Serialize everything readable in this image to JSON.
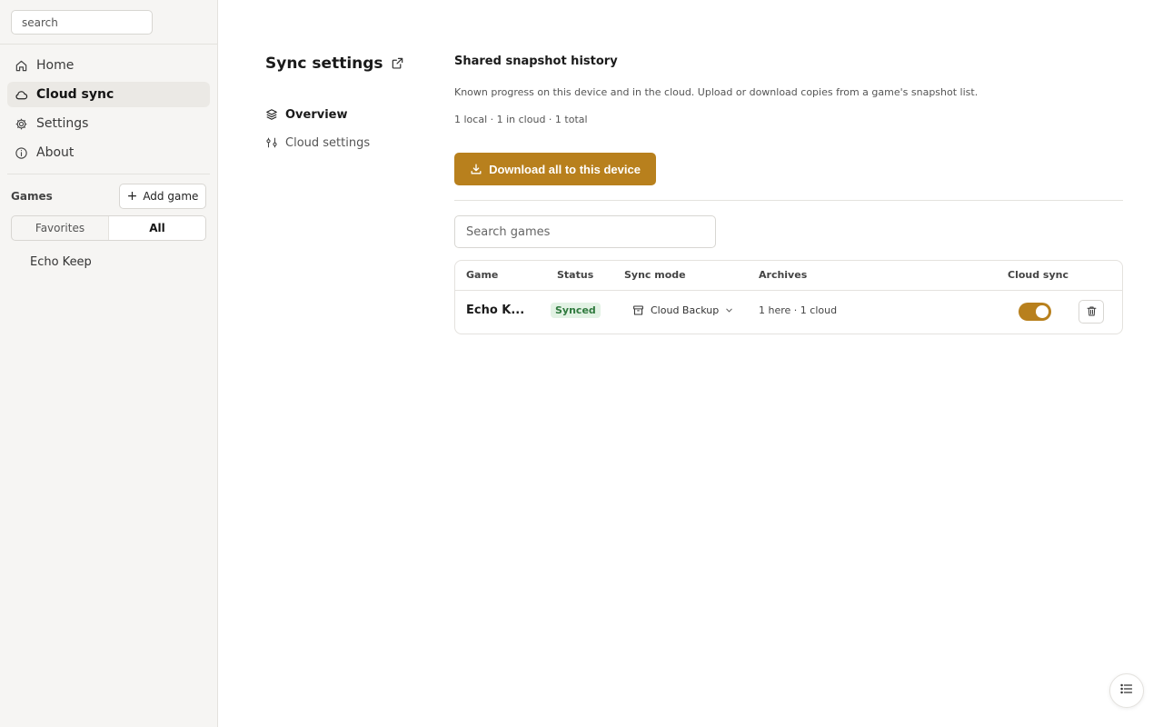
{
  "sidebar": {
    "search_placeholder": "search",
    "nav": [
      {
        "label": "Home",
        "icon": "home-icon"
      },
      {
        "label": "Cloud sync",
        "icon": "cloud-icon",
        "active": true
      },
      {
        "label": "Settings",
        "icon": "gear-icon"
      },
      {
        "label": "About",
        "icon": "info-icon"
      }
    ],
    "games_label": "Games",
    "add_game_label": "Add game",
    "filter": {
      "favorites": "Favorites",
      "all": "All",
      "selected": "All"
    },
    "games": [
      "Echo Keep"
    ]
  },
  "page": {
    "title": "Sync settings",
    "subnav": [
      {
        "label": "Overview",
        "icon": "layers-icon",
        "active": true
      },
      {
        "label": "Cloud settings",
        "icon": "sliders-icon"
      }
    ]
  },
  "section": {
    "title": "Shared snapshot history",
    "description": "Known progress on this device and in the cloud. Upload or download copies from a game's snapshot list.",
    "counts": "1 local · 1 in cloud · 1 total",
    "download_all_label": "Download all to this device",
    "search_placeholder": "Search games"
  },
  "table": {
    "headers": {
      "game": "Game",
      "status": "Status",
      "sync_mode": "Sync mode",
      "archives": "Archives",
      "cloud_sync": "Cloud sync"
    },
    "rows": [
      {
        "game": "Echo K...",
        "status": "Synced",
        "sync_mode": "Cloud Backup",
        "archives": "1 here · 1 cloud",
        "cloud_sync": true
      }
    ]
  },
  "colors": {
    "accent": "#b8801d",
    "status_synced_bg": "#e2f2e4",
    "status_synced_text": "#2f7a3e"
  }
}
